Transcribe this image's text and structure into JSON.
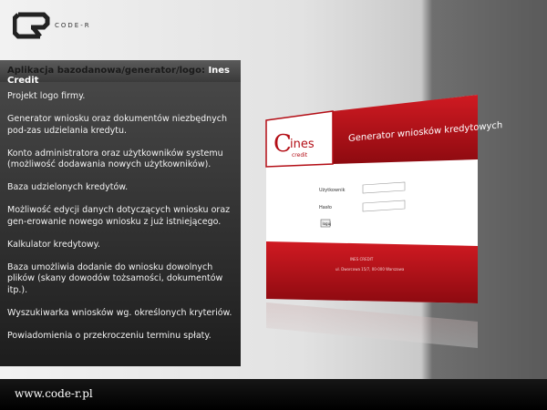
{
  "brand": {
    "logo_text": "CODE-R"
  },
  "panel": {
    "title_prefix": "Aplikacja bazodanowa/generator/logo: ",
    "title_name": "Ines Credit",
    "items": [
      "Projekt logo firmy.",
      "Generator wniosku oraz dokumentów niezbędnych pod-zas udzielania kredytu.",
      "Konto administratora oraz użytkowników systemu (możliwość dodawania nowych użytkowników).",
      "Baza udzielonych kredytów.",
      "Możliwość edycji danych dotyczących wniosku oraz gen-erowanie nowego wniosku z już istniejącego.",
      "Kalkulator kredytowy.",
      "Baza umożliwia dodanie do wniosku dowolnych plików (skany dowodów tożsamości, dokumentów itp.).",
      "Wyszukiwarka wniosków wg. określonych kryteriów.",
      "Powiadomienia o przekroczeniu terminu spłaty."
    ]
  },
  "mockup": {
    "logo_main": "ines",
    "logo_sub": "credit",
    "header_title": "Generator wniosków kredytowych",
    "user_label": "Użytkownik",
    "password_label": "Hasło",
    "login_button": "loguj",
    "footer_line1": "INES CREDIT",
    "footer_line2": "ul. Dworcowa 15/7, 00-000 Warszawa"
  },
  "footer": {
    "url": "www.code-r.pl"
  },
  "colors": {
    "accent": "#b30d15",
    "panel": "#2b2b2b"
  }
}
